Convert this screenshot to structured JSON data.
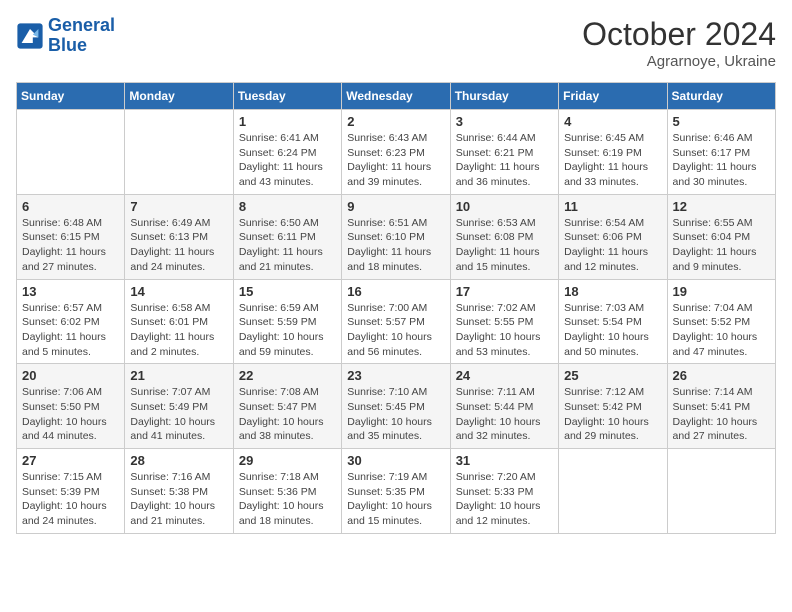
{
  "header": {
    "logo_line1": "General",
    "logo_line2": "Blue",
    "month_year": "October 2024",
    "location": "Agrarnoye, Ukraine"
  },
  "days_of_week": [
    "Sunday",
    "Monday",
    "Tuesday",
    "Wednesday",
    "Thursday",
    "Friday",
    "Saturday"
  ],
  "weeks": [
    [
      {
        "day": "",
        "info": ""
      },
      {
        "day": "",
        "info": ""
      },
      {
        "day": "1",
        "info": "Sunrise: 6:41 AM\nSunset: 6:24 PM\nDaylight: 11 hours and 43 minutes."
      },
      {
        "day": "2",
        "info": "Sunrise: 6:43 AM\nSunset: 6:23 PM\nDaylight: 11 hours and 39 minutes."
      },
      {
        "day": "3",
        "info": "Sunrise: 6:44 AM\nSunset: 6:21 PM\nDaylight: 11 hours and 36 minutes."
      },
      {
        "day": "4",
        "info": "Sunrise: 6:45 AM\nSunset: 6:19 PM\nDaylight: 11 hours and 33 minutes."
      },
      {
        "day": "5",
        "info": "Sunrise: 6:46 AM\nSunset: 6:17 PM\nDaylight: 11 hours and 30 minutes."
      }
    ],
    [
      {
        "day": "6",
        "info": "Sunrise: 6:48 AM\nSunset: 6:15 PM\nDaylight: 11 hours and 27 minutes."
      },
      {
        "day": "7",
        "info": "Sunrise: 6:49 AM\nSunset: 6:13 PM\nDaylight: 11 hours and 24 minutes."
      },
      {
        "day": "8",
        "info": "Sunrise: 6:50 AM\nSunset: 6:11 PM\nDaylight: 11 hours and 21 minutes."
      },
      {
        "day": "9",
        "info": "Sunrise: 6:51 AM\nSunset: 6:10 PM\nDaylight: 11 hours and 18 minutes."
      },
      {
        "day": "10",
        "info": "Sunrise: 6:53 AM\nSunset: 6:08 PM\nDaylight: 11 hours and 15 minutes."
      },
      {
        "day": "11",
        "info": "Sunrise: 6:54 AM\nSunset: 6:06 PM\nDaylight: 11 hours and 12 minutes."
      },
      {
        "day": "12",
        "info": "Sunrise: 6:55 AM\nSunset: 6:04 PM\nDaylight: 11 hours and 9 minutes."
      }
    ],
    [
      {
        "day": "13",
        "info": "Sunrise: 6:57 AM\nSunset: 6:02 PM\nDaylight: 11 hours and 5 minutes."
      },
      {
        "day": "14",
        "info": "Sunrise: 6:58 AM\nSunset: 6:01 PM\nDaylight: 11 hours and 2 minutes."
      },
      {
        "day": "15",
        "info": "Sunrise: 6:59 AM\nSunset: 5:59 PM\nDaylight: 10 hours and 59 minutes."
      },
      {
        "day": "16",
        "info": "Sunrise: 7:00 AM\nSunset: 5:57 PM\nDaylight: 10 hours and 56 minutes."
      },
      {
        "day": "17",
        "info": "Sunrise: 7:02 AM\nSunset: 5:55 PM\nDaylight: 10 hours and 53 minutes."
      },
      {
        "day": "18",
        "info": "Sunrise: 7:03 AM\nSunset: 5:54 PM\nDaylight: 10 hours and 50 minutes."
      },
      {
        "day": "19",
        "info": "Sunrise: 7:04 AM\nSunset: 5:52 PM\nDaylight: 10 hours and 47 minutes."
      }
    ],
    [
      {
        "day": "20",
        "info": "Sunrise: 7:06 AM\nSunset: 5:50 PM\nDaylight: 10 hours and 44 minutes."
      },
      {
        "day": "21",
        "info": "Sunrise: 7:07 AM\nSunset: 5:49 PM\nDaylight: 10 hours and 41 minutes."
      },
      {
        "day": "22",
        "info": "Sunrise: 7:08 AM\nSunset: 5:47 PM\nDaylight: 10 hours and 38 minutes."
      },
      {
        "day": "23",
        "info": "Sunrise: 7:10 AM\nSunset: 5:45 PM\nDaylight: 10 hours and 35 minutes."
      },
      {
        "day": "24",
        "info": "Sunrise: 7:11 AM\nSunset: 5:44 PM\nDaylight: 10 hours and 32 minutes."
      },
      {
        "day": "25",
        "info": "Sunrise: 7:12 AM\nSunset: 5:42 PM\nDaylight: 10 hours and 29 minutes."
      },
      {
        "day": "26",
        "info": "Sunrise: 7:14 AM\nSunset: 5:41 PM\nDaylight: 10 hours and 27 minutes."
      }
    ],
    [
      {
        "day": "27",
        "info": "Sunrise: 7:15 AM\nSunset: 5:39 PM\nDaylight: 10 hours and 24 minutes."
      },
      {
        "day": "28",
        "info": "Sunrise: 7:16 AM\nSunset: 5:38 PM\nDaylight: 10 hours and 21 minutes."
      },
      {
        "day": "29",
        "info": "Sunrise: 7:18 AM\nSunset: 5:36 PM\nDaylight: 10 hours and 18 minutes."
      },
      {
        "day": "30",
        "info": "Sunrise: 7:19 AM\nSunset: 5:35 PM\nDaylight: 10 hours and 15 minutes."
      },
      {
        "day": "31",
        "info": "Sunrise: 7:20 AM\nSunset: 5:33 PM\nDaylight: 10 hours and 12 minutes."
      },
      {
        "day": "",
        "info": ""
      },
      {
        "day": "",
        "info": ""
      }
    ]
  ]
}
